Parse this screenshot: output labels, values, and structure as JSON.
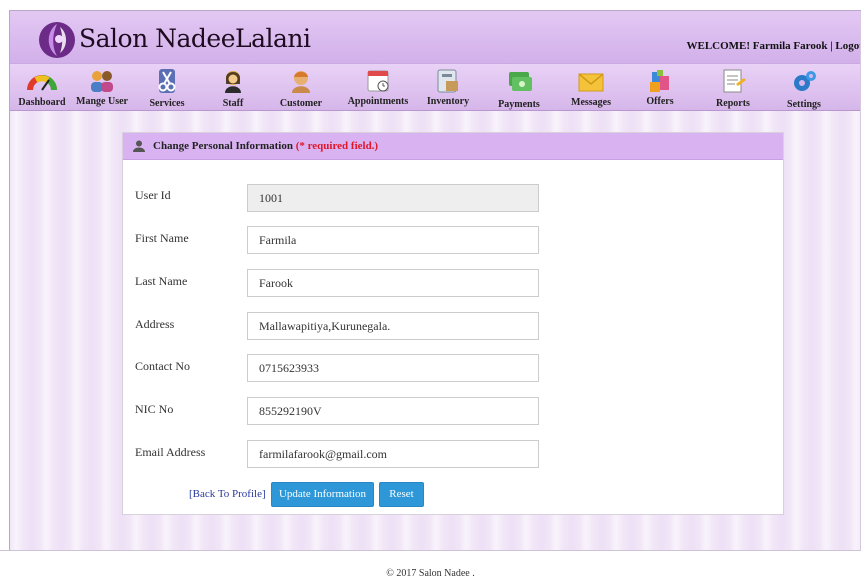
{
  "header": {
    "brand": "Salon NadeeLalani",
    "welcome": "WELCOME! Farmila Farook | Logout"
  },
  "nav": {
    "items": [
      {
        "label": "Dashboard",
        "icon": "gauge-icon"
      },
      {
        "label": "Mange User",
        "icon": "users-icon"
      },
      {
        "label": "Services",
        "icon": "scissors-icon"
      },
      {
        "label": "Staff",
        "icon": "staff-icon"
      },
      {
        "label": "Customer",
        "icon": "customer-icon"
      },
      {
        "label": "Appointments",
        "icon": "calendar-icon"
      },
      {
        "label": "Inventory",
        "icon": "inventory-icon"
      },
      {
        "label": "Payments",
        "icon": "money-icon"
      },
      {
        "label": "Messages",
        "icon": "envelope-icon"
      },
      {
        "label": "Offers",
        "icon": "gift-icon"
      },
      {
        "label": "Reports",
        "icon": "report-icon"
      },
      {
        "label": "Settings",
        "icon": "gears-icon"
      }
    ]
  },
  "form": {
    "title": "Change Personal Information",
    "required_note": "(* required field.)",
    "fields": [
      {
        "label": "User Id",
        "value": "1001"
      },
      {
        "label": "First Name",
        "value": "Farmila"
      },
      {
        "label": "Last Name",
        "value": "Farook"
      },
      {
        "label": "Address",
        "value": "Mallawapitiya,Kurunegala."
      },
      {
        "label": "Contact No",
        "value": "0715623933"
      },
      {
        "label": "NIC No",
        "value": "855292190V"
      },
      {
        "label": "Email Address",
        "value": "farmilafarook@gmail.com"
      }
    ],
    "back_link": "[Back To Profile]",
    "update_label": "Update Information",
    "reset_label": "Reset"
  },
  "footer": {
    "text": "© 2017 Salon Nadee ."
  },
  "colors": {
    "header": "#d9b3f1",
    "button": "#2e97d8",
    "required": "#e0162b"
  }
}
